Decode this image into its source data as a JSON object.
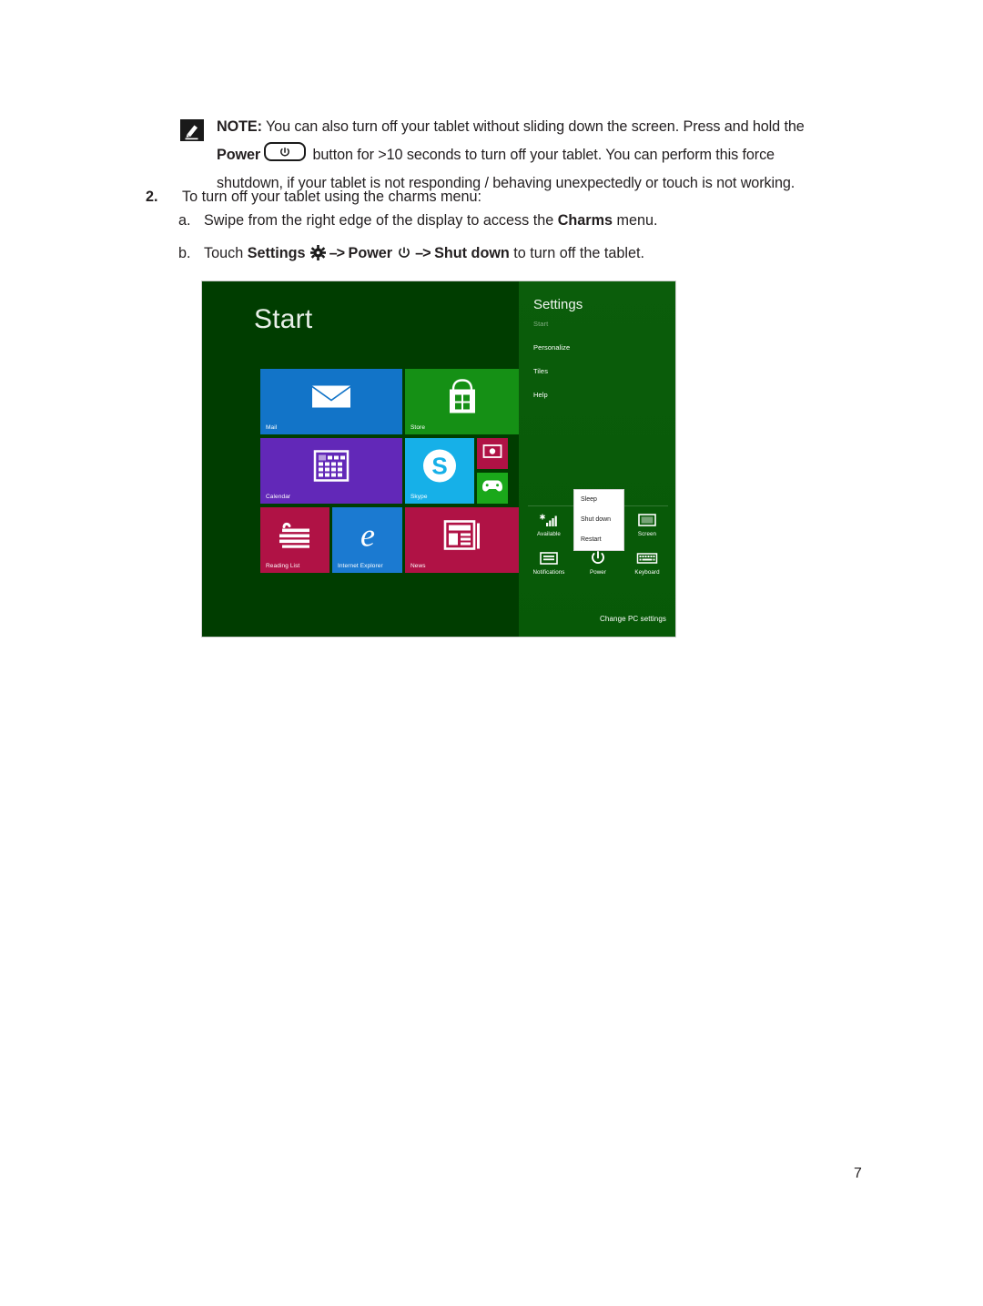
{
  "note": {
    "icon": "note-pencil-icon",
    "label": "NOTE:",
    "line1_rest": " You can also turn off your tablet without sliding down the screen. Press and hold the",
    "power_word": "Power",
    "power_icon": "power-button-icon",
    "line2_rest": " button for >10 seconds to turn off your tablet. You can perform this force",
    "line3": "shutdown, if your tablet is not responding / behaving unexpectedly or touch is not working."
  },
  "steps": {
    "number": "2.",
    "text": "To turn off your tablet using the charms menu:",
    "items": [
      {
        "marker": "a.",
        "pre": "Swipe from the right edge of the display to access the ",
        "bold": "Charms",
        "post": " menu."
      },
      {
        "marker": "b.",
        "pre": "Touch ",
        "bold1": "Settings",
        "gear_icon": "gear-icon",
        "arrow1": "–>",
        "bold2": "Power",
        "power_icon": "power-icon",
        "arrow2": "–>",
        "bold3": "Shut down",
        "post": " to turn off the tablet."
      }
    ]
  },
  "screenshot": {
    "name": "windows-start-screen-with-settings-charm",
    "start_title": "Start",
    "background_color": "#003d00",
    "tiles": [
      {
        "label": "Mail",
        "icon": "mail-envelope-icon",
        "color": "#1274c8"
      },
      {
        "label": "Store",
        "icon": "store-bag-icon",
        "color": "#159015"
      },
      {
        "label": "Calendar",
        "icon": "calendar-grid-icon",
        "color": "#6228b8"
      },
      {
        "label": "Skype",
        "icon": "skype-icon",
        "color": "#16b0e8"
      },
      {
        "label": "",
        "icon": "camera-icon",
        "color": "#b01245"
      },
      {
        "label": "",
        "icon": "xbox-games-icon",
        "color": "#1aa81a"
      },
      {
        "label": "Reading List",
        "icon": "reading-list-icon",
        "color": "#b01245"
      },
      {
        "label": "Internet Explorer",
        "icon": "internet-explorer-icon",
        "color": "#1b7ad1"
      },
      {
        "label": "News",
        "icon": "news-icon",
        "color": "#b01245"
      }
    ],
    "charm": {
      "title": "Settings",
      "links": [
        {
          "label": "Start",
          "dim": true
        },
        {
          "label": "Personalize",
          "dim": false
        },
        {
          "label": "Tiles",
          "dim": false
        },
        {
          "label": "Help",
          "dim": false
        }
      ],
      "icons": [
        {
          "label": "Available",
          "icon": "network-signal-icon"
        },
        {
          "label": "",
          "icon": "volume-icon"
        },
        {
          "label": "Screen",
          "icon": "screen-brightness-icon"
        },
        {
          "label": "Notifications",
          "icon": "notifications-icon"
        },
        {
          "label": "Power",
          "icon": "power-icon"
        },
        {
          "label": "Keyboard",
          "icon": "keyboard-icon"
        }
      ],
      "power_menu": [
        {
          "label": "Sleep"
        },
        {
          "label": "Shut down"
        },
        {
          "label": "Restart"
        }
      ],
      "change_pc_settings": "Change PC settings"
    }
  },
  "footer": {
    "page_number": "7"
  }
}
